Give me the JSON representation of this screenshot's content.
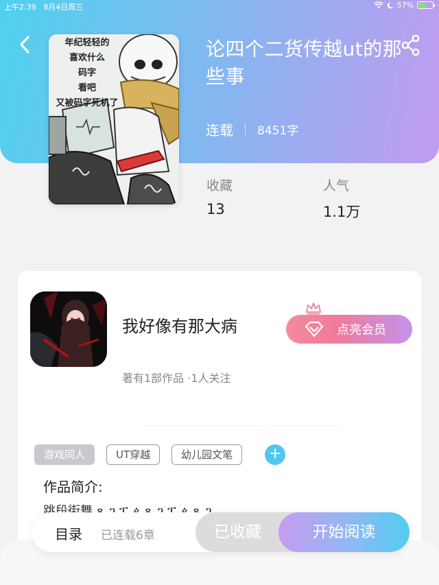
{
  "status_bar": {
    "time": "上午2:39",
    "date": "8月4日周三",
    "battery": "57%",
    "battery_level": 0.57,
    "icons": [
      "wifi-icon",
      "moon-icon",
      "battery-icon"
    ]
  },
  "header": {
    "back_icon": "chevron-left-icon",
    "share_icon": "share-icon",
    "cover_caption": [
      "年纪轻轻的",
      "喜欢什么",
      "码字",
      "看吧",
      "又被码字死机了"
    ],
    "title": "论四个二货传越ut的那些事",
    "status": "连载",
    "word_count": "8451字"
  },
  "stats": {
    "favorites_label": "收藏",
    "favorites_value": "13",
    "popularity_label": "人气",
    "popularity_value": "1.1万"
  },
  "author": {
    "name": "我好像有那大病",
    "subtitle": "著有1部作品 ·1人关注",
    "vip_button": "点亮会员"
  },
  "tags": [
    "游戏同人",
    "UT穿越",
    "幼儿园文笔"
  ],
  "intro": {
    "title": "作品简介:",
    "text": "跳段街舞 ጸ ጋ ፔ ዾ ጸ ጋ ፔ ዾ ጸ ጋ"
  },
  "bottom_bar": {
    "toc_label": "目录",
    "chapters": "已连载6章",
    "collected_label": "已收藏",
    "read_label": "开始阅读"
  },
  "colors": {
    "gradient_start": "#4fd1ef",
    "gradient_end": "#c19bef",
    "vip_pink": "#f58aa0",
    "tag_add": "#4fc7ef"
  }
}
